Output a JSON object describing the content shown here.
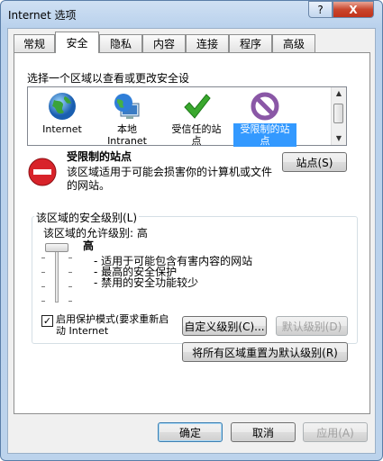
{
  "window": {
    "title": "Internet 选项",
    "help_label": "?",
    "close_label": "X"
  },
  "tabs": [
    {
      "label": "常规"
    },
    {
      "label": "安全"
    },
    {
      "label": "隐私"
    },
    {
      "label": "内容"
    },
    {
      "label": "连接"
    },
    {
      "label": "程序"
    },
    {
      "label": "高级"
    }
  ],
  "active_tab": "安全",
  "security": {
    "zone_prompt": "选择一个区域以查看或更改安全设",
    "zones": [
      {
        "label": "Internet",
        "icon": "globe-icon"
      },
      {
        "label": "本地\nIntranet",
        "icon": "intranet-globe-icon"
      },
      {
        "label": "受信任的站\n点",
        "icon": "green-check-icon"
      },
      {
        "label": "受限制的站\n点",
        "icon": "restricted-circle-icon",
        "selected": true
      }
    ],
    "selected_zone": {
      "title": "受限制的站点",
      "description": "该区域适用于可能会损害你的计算机或文件的网站。",
      "sites_button": "站点(S)",
      "icon": "no-entry-icon"
    },
    "level_group_label": "该区域的安全级别(L)",
    "allowed_levels_label": "该区域的允许级别: 高",
    "level_name": "高",
    "level_bullets": [
      "- 适用于可能包含有害内容的网站",
      "- 最高的安全保护",
      "- 禁用的安全功能较少"
    ],
    "slider_level_fraction": 1.0,
    "protected_mode_label": "启用保护模式(要求重新启动 Internet",
    "protected_mode_checked": true,
    "custom_level_button": "自定义级别(C)...",
    "default_level_button": "默认级别(D)",
    "reset_all_button": "将所有区域重置为默认级别(R)"
  },
  "footer": {
    "ok": "确定",
    "cancel": "取消",
    "apply": "应用(A)"
  },
  "colors": {
    "accent": "#3399ff",
    "title_bar": "#bcd3ec",
    "panel": "#ffffff"
  }
}
